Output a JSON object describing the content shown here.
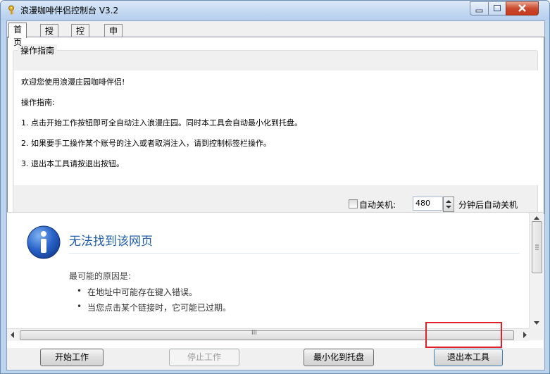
{
  "window": {
    "title": "浪漫咖啡伴侣控制台 V3.2"
  },
  "tabs": [
    "首页",
    "授权",
    "控制",
    "申明"
  ],
  "guide": {
    "title": "操作指南",
    "lines": [
      "欢迎您使用浪漫庄园咖啡伴侣!",
      "操作指南:",
      "1. 点击开始工作按钮即可全自动注入浪漫庄园。同时本工具会自动最小化到托盘。",
      "2. 如果要手工操作某个账号的注入或者取消注入，请到控制标签栏操作。",
      "3. 退出本工具请按退出按钮。"
    ]
  },
  "auto_shutdown": {
    "label": "自动关机:",
    "minutes": "480",
    "suffix": "分钟后自动关机",
    "checked": false
  },
  "browser_error": {
    "title": "无法找到该网页",
    "reason_heading": "最可能的原因是:",
    "reasons": [
      "在地址中可能存在键入错误。",
      "当您点击某个链接时，它可能已过期。"
    ],
    "scroll_marker": "III"
  },
  "buttons": {
    "start": "开始工作",
    "stop": "停止工作",
    "minimize_tray": "最小化到托盘",
    "exit": "退出本工具"
  },
  "colors": {
    "title_accent": "#1f5cad",
    "highlight": "#e0212a"
  },
  "icons": {
    "app": "key-icon",
    "info": "info-icon"
  }
}
